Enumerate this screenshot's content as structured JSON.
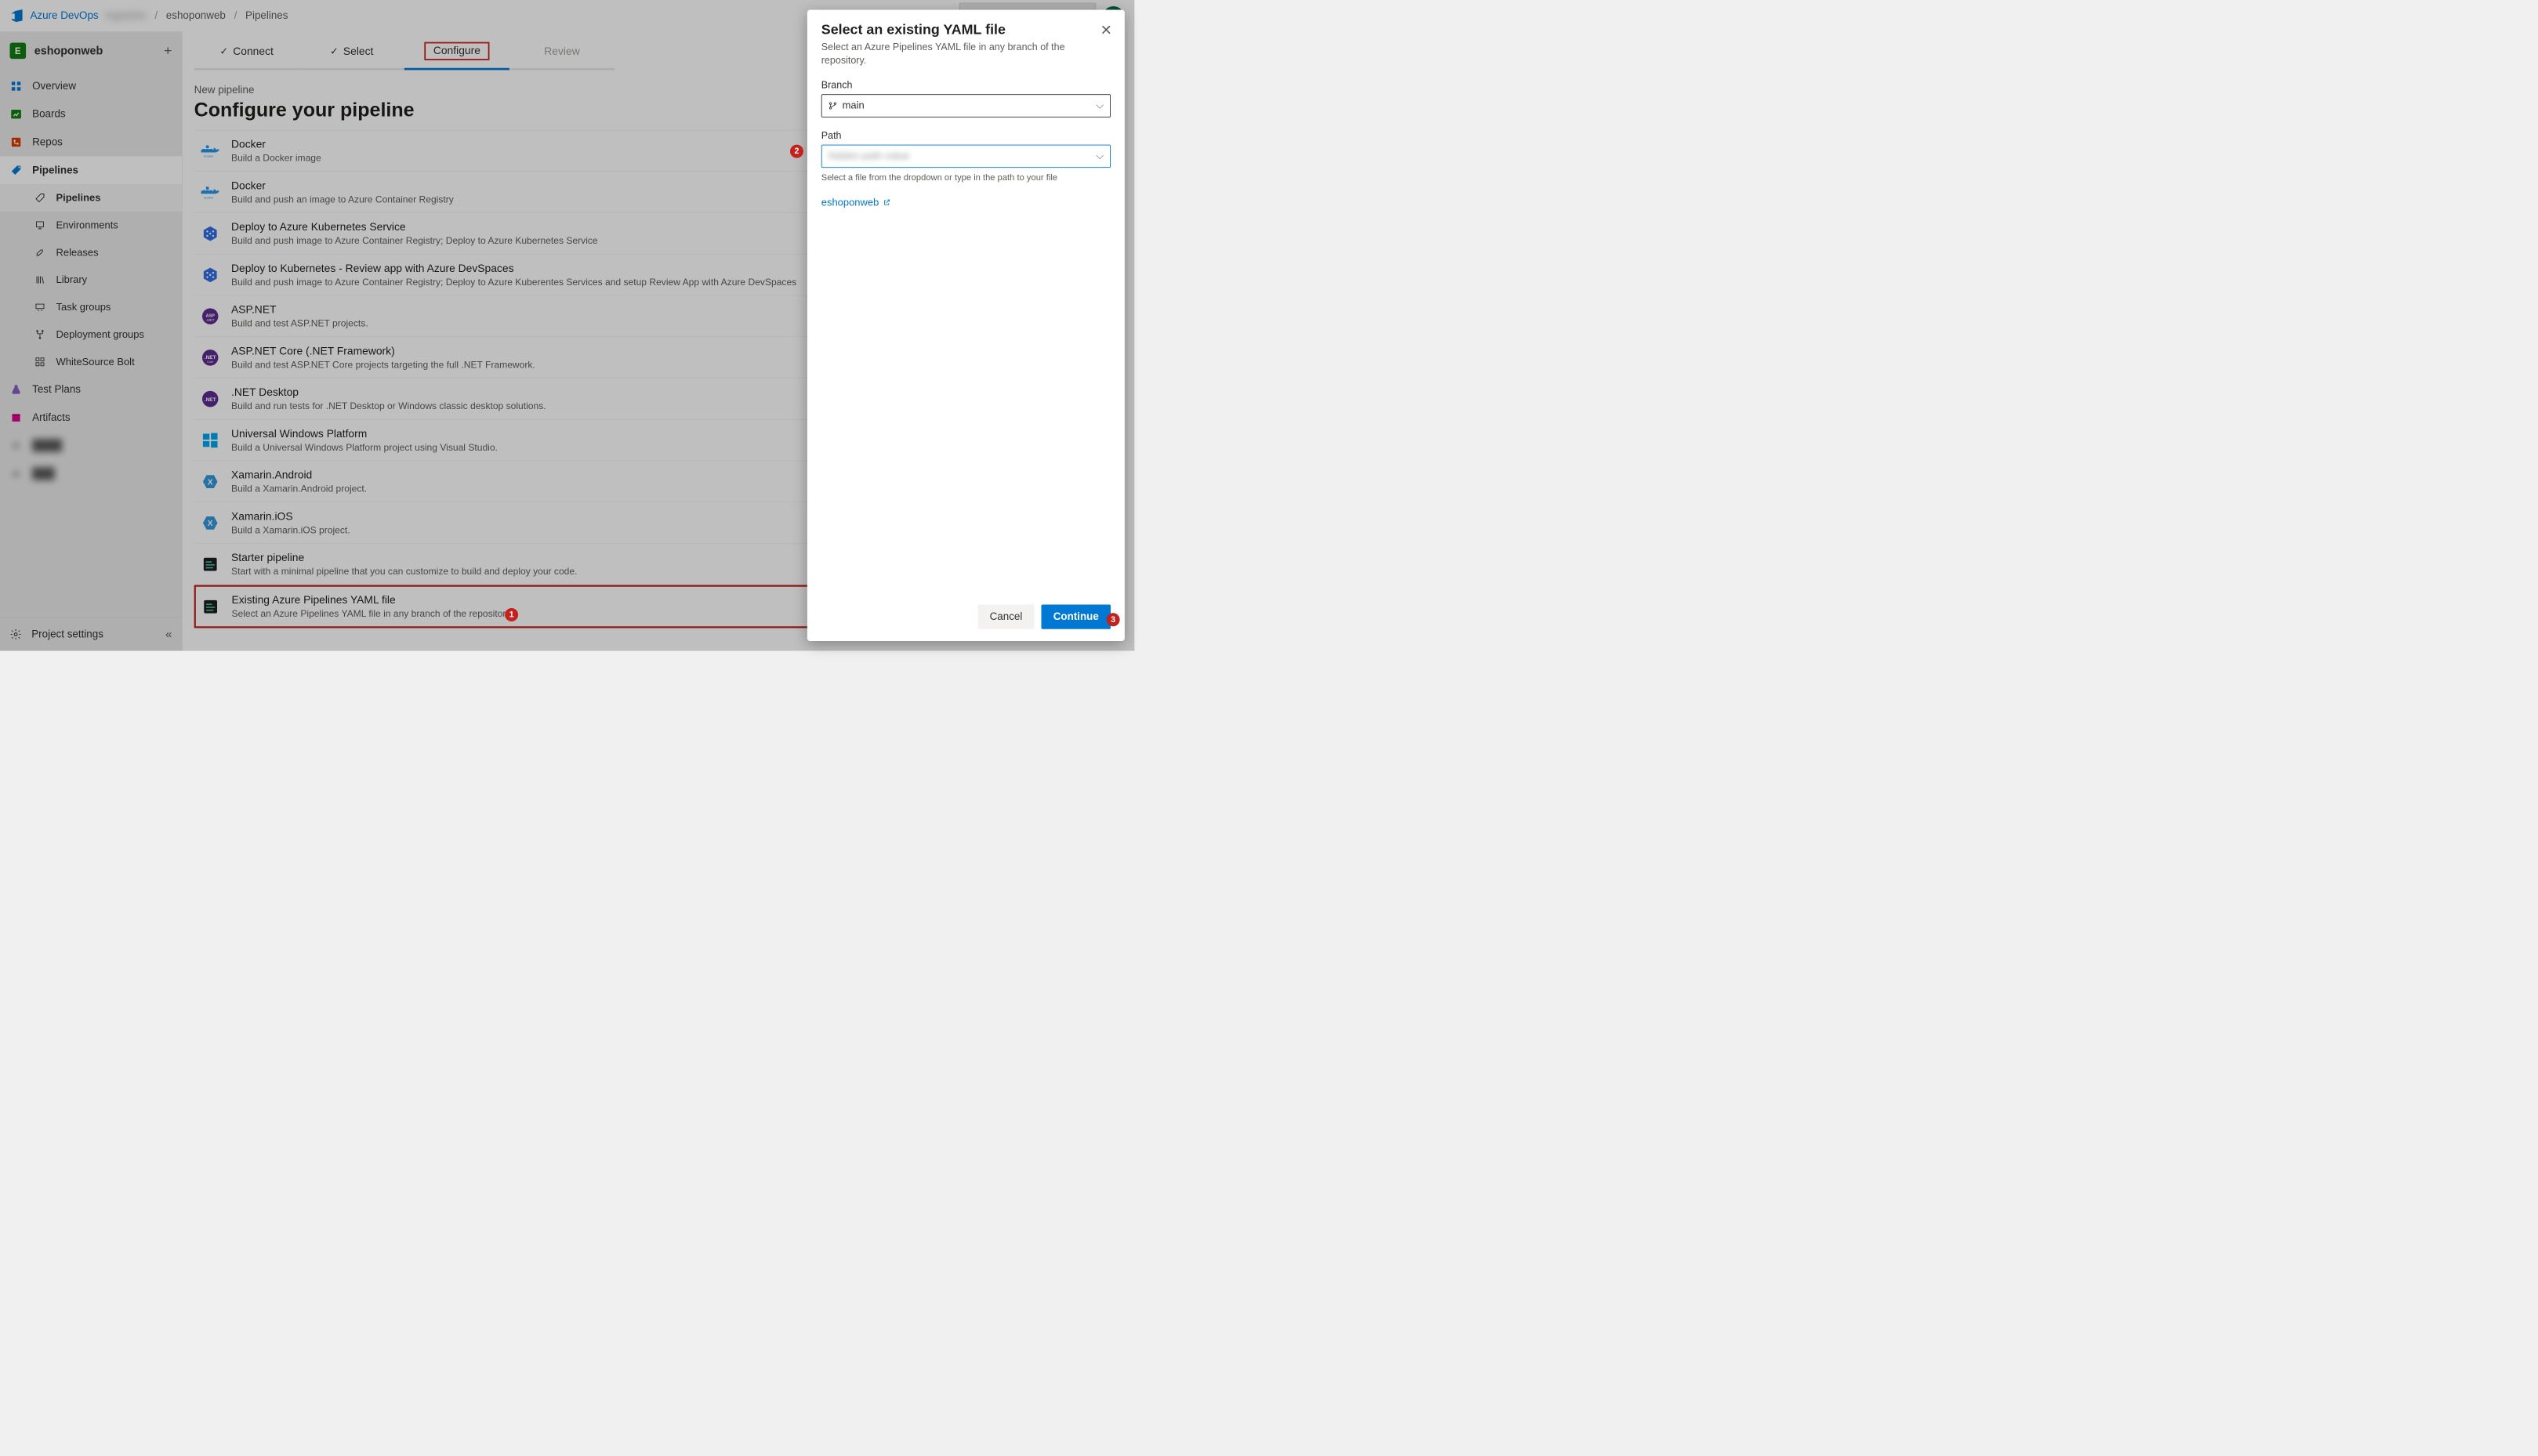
{
  "brand": "Azure DevOps",
  "breadcrumb": {
    "org": "",
    "project": "eshoponweb",
    "section": "Pipelines"
  },
  "project": {
    "initial": "E",
    "name": "eshoponweb"
  },
  "sidebar": {
    "items": [
      {
        "label": "Overview"
      },
      {
        "label": "Boards"
      },
      {
        "label": "Repos"
      },
      {
        "label": "Pipelines"
      },
      {
        "label": "Pipelines"
      },
      {
        "label": "Environments"
      },
      {
        "label": "Releases"
      },
      {
        "label": "Library"
      },
      {
        "label": "Task groups"
      },
      {
        "label": "Deployment groups"
      },
      {
        "label": "WhiteSource Bolt"
      },
      {
        "label": "Test Plans"
      },
      {
        "label": "Artifacts"
      }
    ],
    "footer": "Project settings"
  },
  "wizard": {
    "steps": [
      "Connect",
      "Select",
      "Configure",
      "Review"
    ],
    "breadcrumb": "New pipeline",
    "title": "Configure your pipeline"
  },
  "templates": [
    {
      "title": "Docker",
      "desc": "Build a Docker image"
    },
    {
      "title": "Docker",
      "desc": "Build and push an image to Azure Container Registry"
    },
    {
      "title": "Deploy to Azure Kubernetes Service",
      "desc": "Build and push image to Azure Container Registry; Deploy to Azure Kubernetes Service"
    },
    {
      "title": "Deploy to Kubernetes - Review app with Azure DevSpaces",
      "desc": "Build and push image to Azure Container Registry; Deploy to Azure Kuberentes Services and setup Review App with Azure DevSpaces"
    },
    {
      "title": "ASP.NET",
      "desc": "Build and test ASP.NET projects."
    },
    {
      "title": "ASP.NET Core (.NET Framework)",
      "desc": "Build and test ASP.NET Core projects targeting the full .NET Framework."
    },
    {
      "title": ".NET Desktop",
      "desc": "Build and run tests for .NET Desktop or Windows classic desktop solutions."
    },
    {
      "title": "Universal Windows Platform",
      "desc": "Build a Universal Windows Platform project using Visual Studio."
    },
    {
      "title": "Xamarin.Android",
      "desc": "Build a Xamarin.Android project."
    },
    {
      "title": "Xamarin.iOS",
      "desc": "Build a Xamarin.iOS project."
    },
    {
      "title": "Starter pipeline",
      "desc": "Start with a minimal pipeline that you can customize to build and deploy your code."
    },
    {
      "title": "Existing Azure Pipelines YAML file",
      "desc": "Select an Azure Pipelines YAML file in any branch of the repository."
    }
  ],
  "panel": {
    "title": "Select an existing YAML file",
    "subtitle": "Select an Azure Pipelines YAML file in any branch of the repository.",
    "branch_label": "Branch",
    "branch_value": "main",
    "path_label": "Path",
    "path_value": "",
    "path_hint": "Select a file from the dropdown or type in the path to your file",
    "repo_link": "eshoponweb",
    "cancel": "Cancel",
    "continue": "Continue"
  },
  "callouts": {
    "a": "1",
    "b": "2",
    "c": "3"
  }
}
